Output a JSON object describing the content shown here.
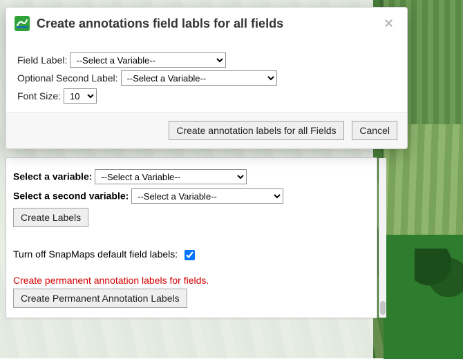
{
  "modal": {
    "title": "Create annotations field labls for all fields",
    "field_label_label": "Field Label:",
    "field_label_value": "--Select a Variable--",
    "optional_second_label_label": "Optional Second Label:",
    "optional_second_label_value": "--Select a Variable--",
    "font_size_label": "Font Size:",
    "font_size_value": "10",
    "btn_create": "Create annotation labels for all Fields",
    "btn_cancel": "Cancel"
  },
  "panel": {
    "select_variable_label": "Select a variable:",
    "select_variable_value": "--Select a Variable--",
    "select_second_variable_label": "Select a second variable:",
    "select_second_variable_value": "--Select a Variable--",
    "btn_create_labels": "Create Labels",
    "turn_off_default_label": "Turn off SnapMaps default field labels:",
    "turn_off_checked": true,
    "perm_note": "Create permanent annotation labels for fields.",
    "btn_perm": "Create Permanent Annotation Labels"
  }
}
